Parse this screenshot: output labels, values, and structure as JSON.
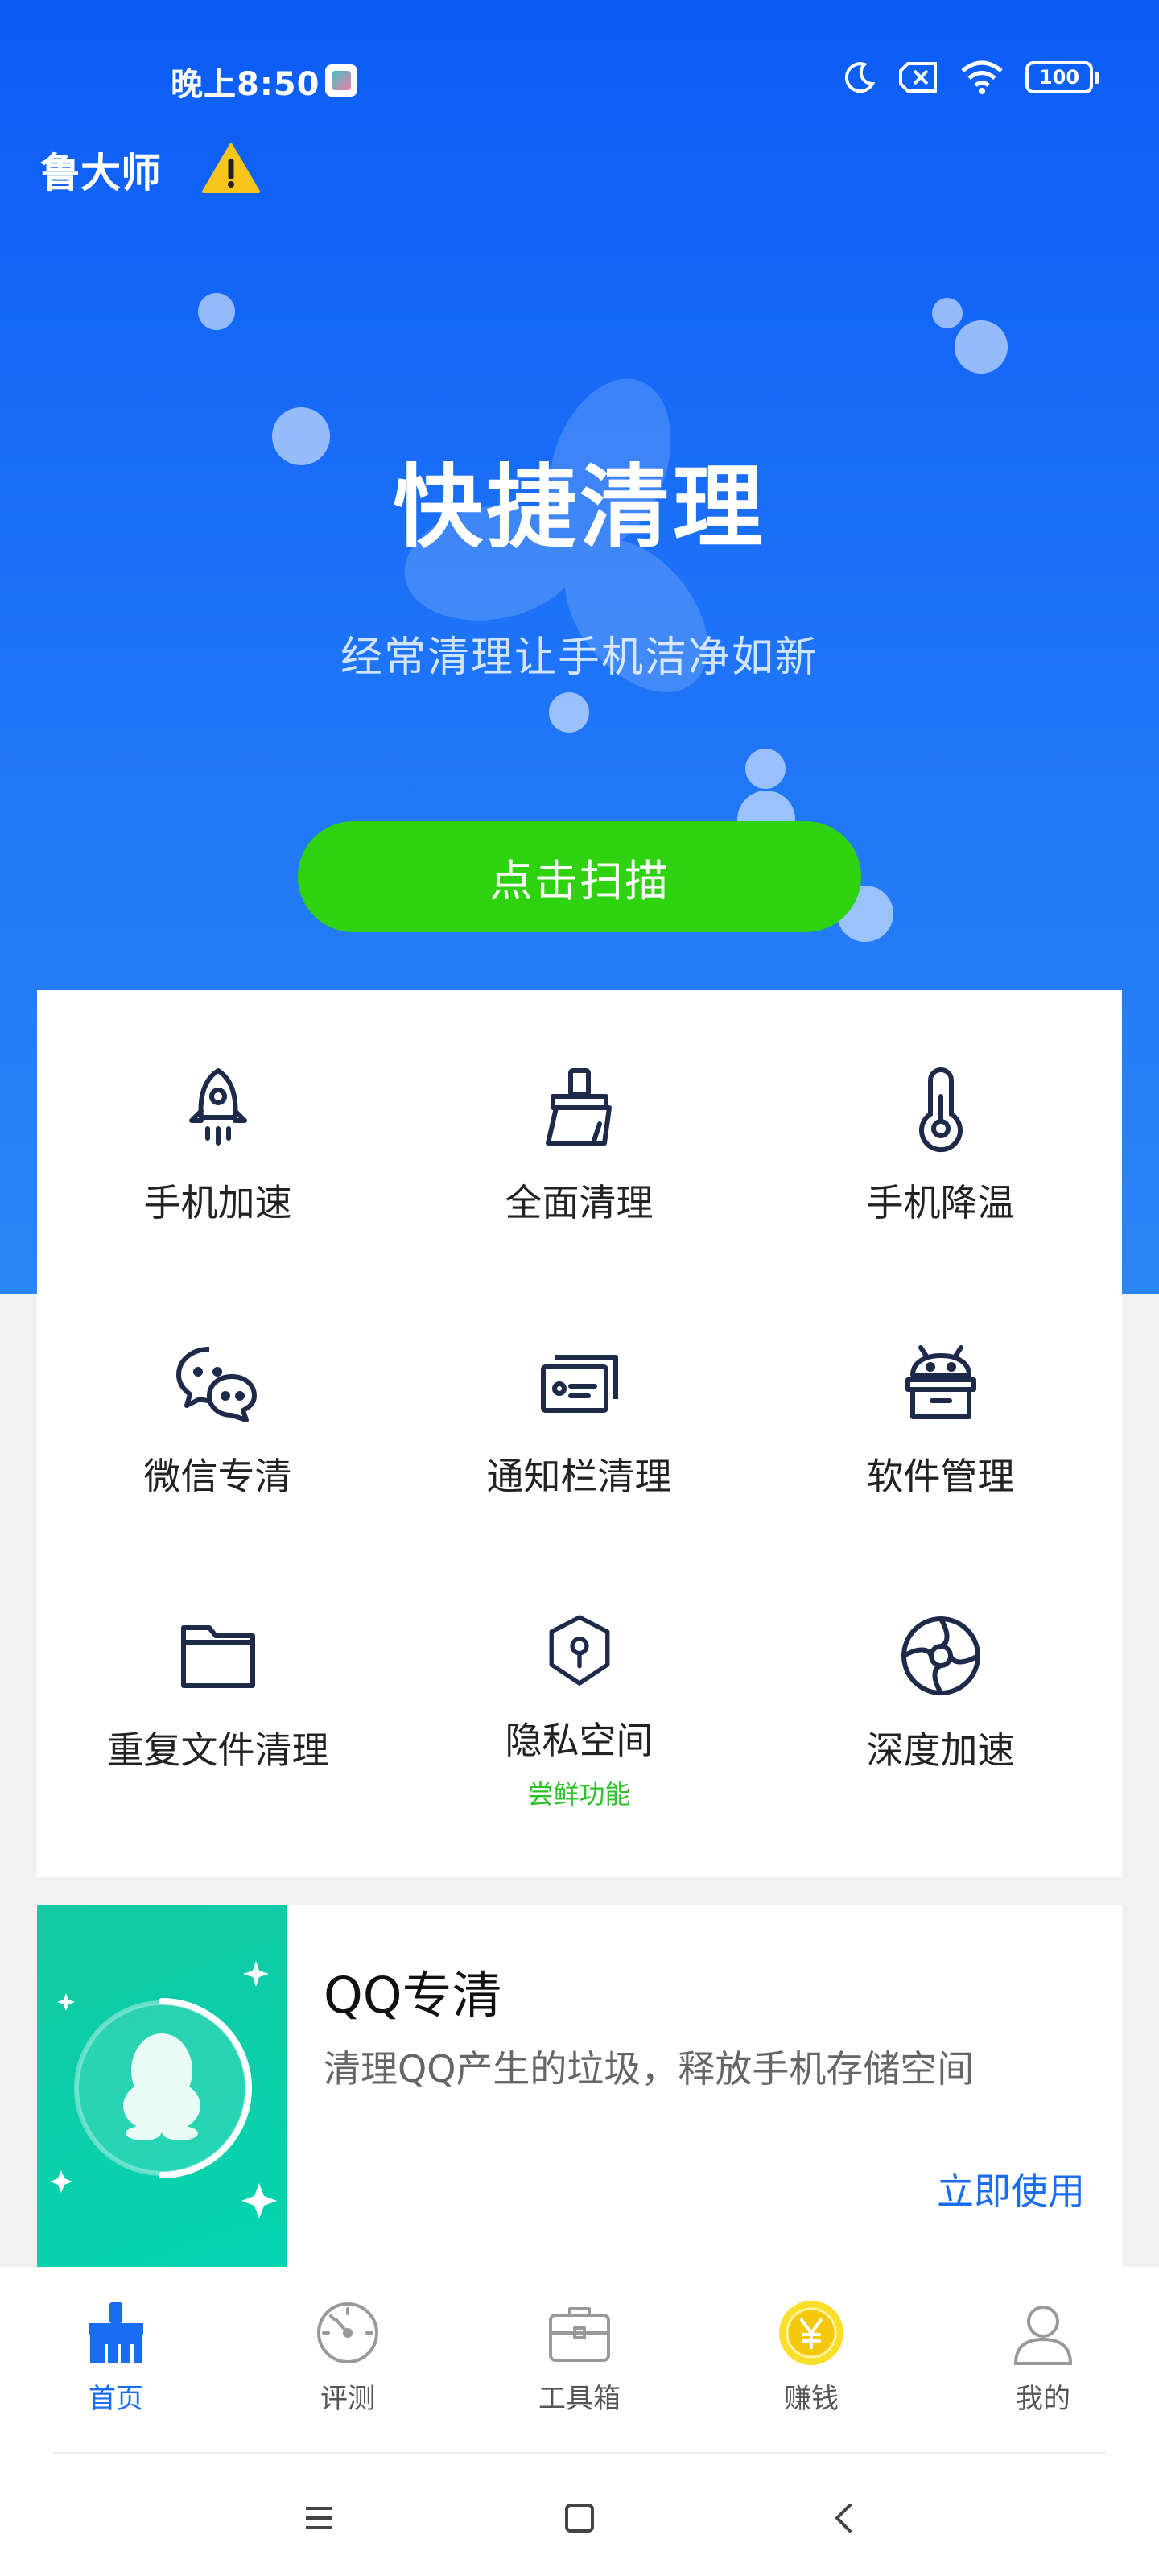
{
  "status_bar": {
    "time": "晚上8:50",
    "battery": "100"
  },
  "header": {
    "brand": "鲁大师"
  },
  "hero": {
    "title": "快捷清理",
    "subtitle": "经常清理让手机洁净如新",
    "scan_button": "点击扫描"
  },
  "features": [
    {
      "label": "手机加速",
      "icon": "rocket-icon"
    },
    {
      "label": "全面清理",
      "icon": "broom-icon"
    },
    {
      "label": "手机降温",
      "icon": "thermometer-icon"
    },
    {
      "label": "微信专清",
      "icon": "wechat-icon"
    },
    {
      "label": "通知栏清理",
      "icon": "notification-icon"
    },
    {
      "label": "软件管理",
      "icon": "android-icon"
    },
    {
      "label": "重复文件清理",
      "icon": "folder-icon"
    },
    {
      "label": "隐私空间",
      "icon": "shield-lock-icon",
      "sub": "尝鲜功能"
    },
    {
      "label": "深度加速",
      "icon": "aperture-icon"
    }
  ],
  "qq_card": {
    "title": "QQ专清",
    "description": "清理QQ产生的垃圾，释放手机存储空间",
    "action": "立即使用"
  },
  "tabs": [
    {
      "label": "首页",
      "icon": "home-broom-icon",
      "active": true
    },
    {
      "label": "评测",
      "icon": "speedometer-icon"
    },
    {
      "label": "工具箱",
      "icon": "toolbox-icon"
    },
    {
      "label": "赚钱",
      "icon": "coin-icon"
    },
    {
      "label": "我的",
      "icon": "user-icon"
    }
  ],
  "colors": {
    "hero_blue": "#0b5cf6",
    "scan_green": "#2ed20e",
    "accent_blue": "#1a6cf0",
    "qq_green": "#05d4b0"
  }
}
